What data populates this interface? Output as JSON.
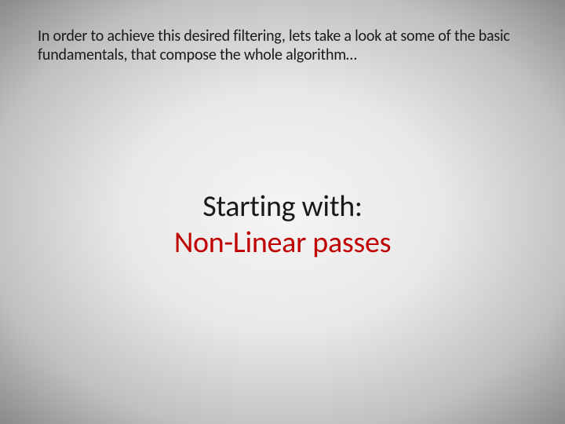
{
  "intro": "In order to achieve this desired filtering, lets take a look at some of the basic fundamentals, that compose the whole algorithm…",
  "center": {
    "line1": "Starting with:",
    "line2": "Non-Linear passes"
  },
  "colors": {
    "text": "#1a1a1a",
    "accent": "#c00000"
  }
}
